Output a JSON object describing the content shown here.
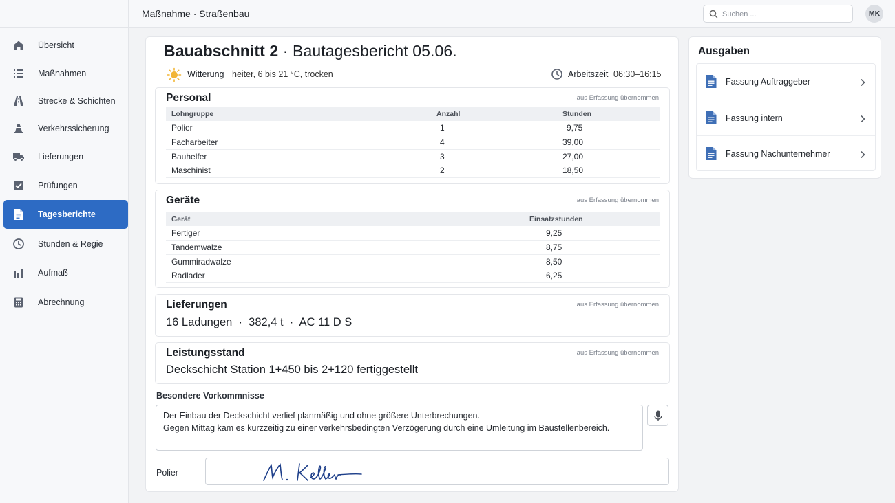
{
  "header": {
    "breadcrumb": "Maßnahme · Straßenbau",
    "search_placeholder": "Suchen ...",
    "avatar_initials": "MK"
  },
  "sidebar": {
    "items": [
      {
        "label": "Übersicht",
        "icon": "home-icon"
      },
      {
        "label": "Maßnahmen",
        "icon": "list-icon"
      },
      {
        "label": "Strecke & Schichten",
        "icon": "road-icon"
      },
      {
        "label": "Verkehrssicherung",
        "icon": "traffic-cone-icon"
      },
      {
        "label": "Lieferungen",
        "icon": "truck-icon"
      },
      {
        "label": "Prüfungen",
        "icon": "checkbox-icon"
      },
      {
        "label": "Tagesberichte",
        "icon": "document-icon",
        "active": true
      },
      {
        "label": "Stunden & Regie",
        "icon": "clock-icon"
      },
      {
        "label": "Aufmaß",
        "icon": "bar-chart-icon"
      },
      {
        "label": "Abrechnung",
        "icon": "calculator-icon"
      }
    ]
  },
  "report": {
    "title_bold": "Bauabschnitt 2",
    "title_rest": " · Bautagesbericht 05.06.",
    "weather_label": "Witterung",
    "weather_value": "heiter, 6 bis 21 °C, trocken",
    "worktime_label": "Arbeitszeit",
    "worktime_value": "06:30–16:15",
    "source_note": "aus Erfassung übernommen",
    "personal": {
      "title": "Personal",
      "headers": [
        "Lohngruppe",
        "Anzahl",
        "Stunden"
      ],
      "rows": [
        [
          "Polier",
          "1",
          "9,75"
        ],
        [
          "Facharbeiter",
          "4",
          "39,00"
        ],
        [
          "Bauhelfer",
          "3",
          "27,00"
        ],
        [
          "Maschinist",
          "2",
          "18,50"
        ]
      ]
    },
    "geraete": {
      "title": "Geräte",
      "headers": [
        "Gerät",
        "Einsatzstunden"
      ],
      "rows": [
        [
          "Fertiger",
          "9,25"
        ],
        [
          "Tandemwalze",
          "8,75"
        ],
        [
          "Gummiradwalze",
          "8,50"
        ],
        [
          "Radlader",
          "6,25"
        ]
      ]
    },
    "lieferungen": {
      "title": "Lieferungen",
      "summary": "16 Ladungen  ·  382,4 t  ·  AC 11 D S"
    },
    "leistungsstand": {
      "title": "Leistungsstand",
      "summary": "Deckschicht Station 1+450 bis 2+120 fertiggestellt"
    },
    "besondere_label": "Besondere Vorkommnisse",
    "besondere_line1": "Der Einbau der Deckschicht verlief planmäßig und ohne größere Unterbrechungen.",
    "besondere_line2": "Gegen Mittag kam es kurzzeitig zu einer verkehrsbedingten Verzögerung durch eine Umleitung im Baustellenbereich.",
    "polier_label": "Polier",
    "signature": "M. Keller"
  },
  "outputs": {
    "title": "Ausgaben",
    "items": [
      "Fassung Auftraggeber",
      "Fassung intern",
      "Fassung Nachunternehmer"
    ]
  },
  "colors": {
    "accent": "#2d6bc4",
    "icon": "#5b6270",
    "doc_icon": "#3f6fb6"
  }
}
